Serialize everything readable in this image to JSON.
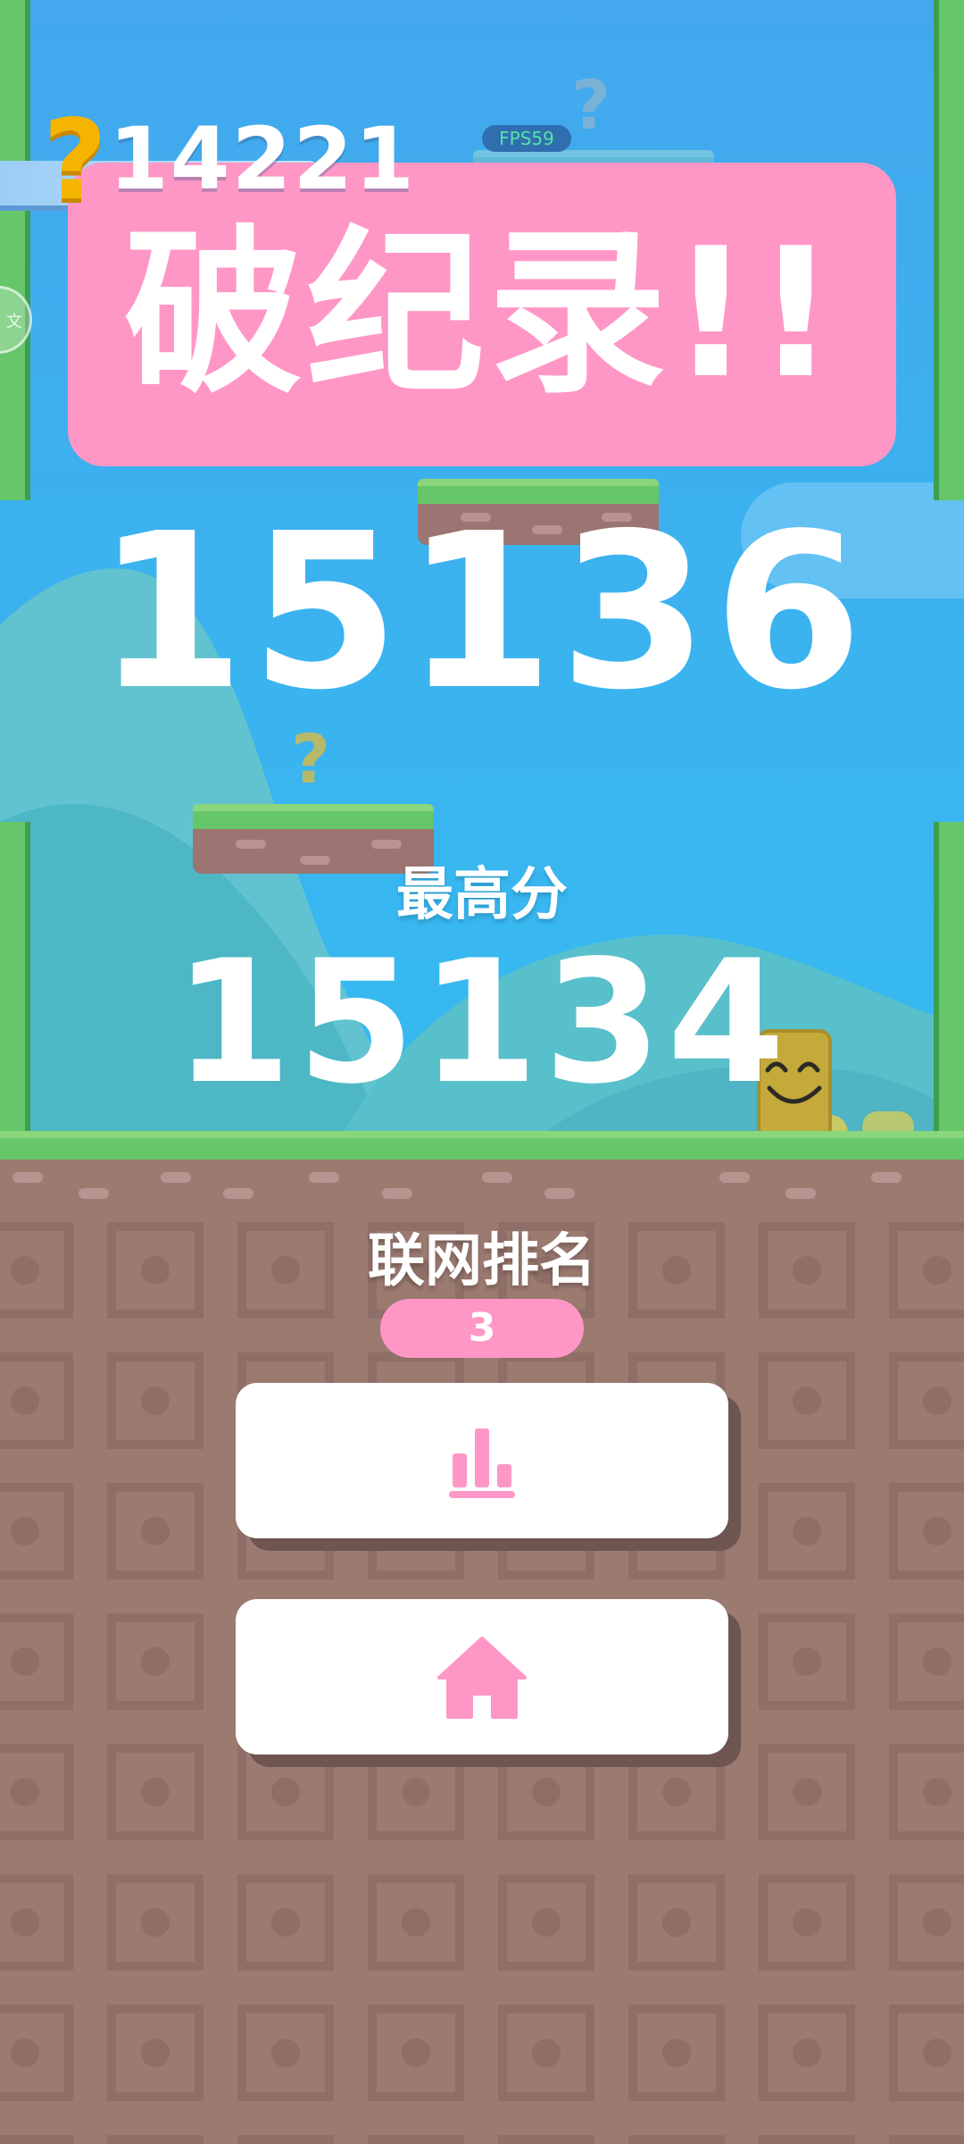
{
  "hud": {
    "icon": "question-mark-icon",
    "score": "14221",
    "fps": "FPS59"
  },
  "banner": {
    "title": "破纪录!!"
  },
  "result": {
    "current_score": "15136",
    "best_label": "最高分",
    "best_score": "15134"
  },
  "ranking": {
    "label": "联网排名",
    "value": "3"
  },
  "buttons": [
    {
      "icon": "leaderboard-icon",
      "color": "#ff97c6"
    },
    {
      "icon": "home-icon",
      "color": "#ff97c6"
    }
  ],
  "colors": {
    "sky": "#43a8ee",
    "banner": "#ff97c6",
    "grass": "#66c66a",
    "ground": "#9b7a70"
  }
}
